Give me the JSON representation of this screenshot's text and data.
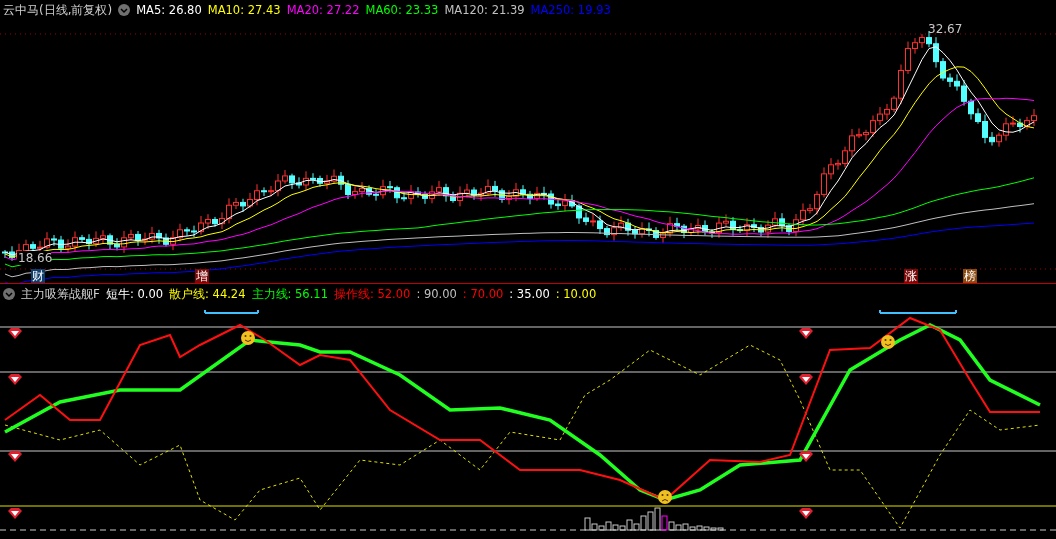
{
  "main_panel": {
    "title": "云中马(日线,前复权)",
    "ma_readings": [
      {
        "text": "MA5: 26.80",
        "color": "#ffffff"
      },
      {
        "text": "MA10: 27.43",
        "color": "#ffff00"
      },
      {
        "text": "MA20: 27.22",
        "color": "#ff00ff"
      },
      {
        "text": "MA60: 23.33",
        "color": "#00ff00"
      },
      {
        "text": "MA120: 21.39",
        "color": "#c0c0c0"
      },
      {
        "text": "MA250: 19.93",
        "color": "#0000ff"
      }
    ],
    "high_label": "32.67",
    "low_label": "18.66",
    "event_tags": [
      {
        "text": "财",
        "color": "#0f3e6e"
      },
      {
        "text": "增",
        "color": "#7a0a0a"
      },
      {
        "text": "涨",
        "color": "#7a0a0a"
      },
      {
        "text": "榜",
        "color": "#8a4a10"
      }
    ]
  },
  "indicator_panel": {
    "title": "主力吸筹战舰F",
    "readings": [
      {
        "text": "短牛: 0.00",
        "color": "#ffffff"
      },
      {
        "text": "散户线: 44.24",
        "color": "#ffff00"
      },
      {
        "text": "主力线: 56.11",
        "color": "#00ff00"
      },
      {
        "text": "操作线: 52.00",
        "color": "#ff0000"
      },
      {
        "text": ": 90.00",
        "color": "#c0c0c0"
      },
      {
        "text": ": 70.00",
        "color": "#ff0000"
      },
      {
        "text": ": 35.00",
        "color": "#ffffff"
      },
      {
        "text": ": 10.00",
        "color": "#ffff00"
      }
    ]
  }
}
